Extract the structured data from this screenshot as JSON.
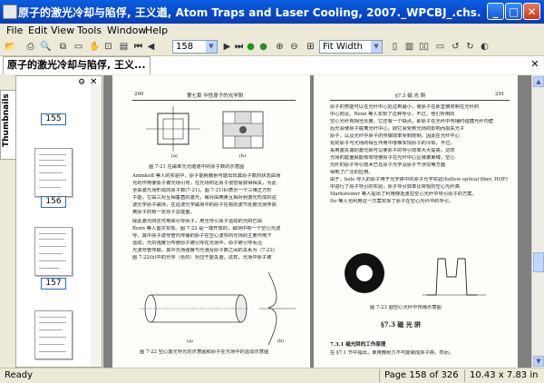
{
  "window": {
    "title": "原子的激光冷却与陷俘, 王义遒, Atom Traps and Laser Cooling, 2007._WPCBJ_.chs.djvu - WinDjView"
  },
  "menu": [
    "File",
    "Edit",
    "View",
    "Tools",
    "Window",
    "Help"
  ],
  "toolbar": {
    "page_number": "158",
    "zoom": "Fit Width"
  },
  "tab": {
    "label": "原子的激光冷却与陷俘, 王义..."
  },
  "sidebar": {
    "tab_label": "Thumbnails",
    "pages": [
      "155",
      "156",
      "157",
      "158"
    ]
  },
  "left_page": {
    "number": "290",
    "running_title": "第七章  中性原子的光学阱",
    "figure1_caption": "图 7-21  在磁单元光隧道中的原子数的示意图",
    "paragraphs": [
      "Ammkoff 等人的实验中，原子能耗散射可能出现其原子数的状态由场",
      "光的作用使原子被光场引导，在光场附近原子很容易获得相关，为此",
      "全由激光场形成的原子数(7-21)。图 7-21(b)表示一个三维正方形",
      "子能，它由三对互相垂直的激光，每对由两束互相对射激光形成的驻",
      "波光学原子磁场，在驻波光学磁场中的原子在有的波节处被光场俘获",
      "离原子的有一定原子总能量。",
      "除此激光阱还可用来引导原子，用光导引原子运动的光阱已由",
      "Renn 等人首次实现。图 7-22 是一端开放的，磁场中有一个空心光波",
      "导，其中原子波导管内传播的原子在空心波导的光场的主要作用下",
      "运动。光的强度分布使原子被引导在光场中，原子被引导而沿",
      "光波导管传输，其中光场强度与光强及原子数之间的关系为（7-22）",
      "图 7-22(b)中的光导（负的）对应于蓝失谐，这样，光场中原子被"
    ],
    "figure2_caption": "图 7-22  空心激光导光的示意图和原子在光场中的运动示意图"
  },
  "right_page": {
    "number": "291",
    "running_title": "§7.3  磁 光 阱",
    "paragraphs": [
      "原子的势能可以在光纤中心处达到最小，使原子在那里被限制在光纤的",
      "中心附近。Renn 等人实现了这种导引，不过，他们所用的",
      "空心光纤有相当长度，它还有一个缺点，即原子在光纤中传播时碰撞光纤内壁",
      "后光会使原子脱离光纤中心，即它会受到光场的影响而损失光子",
      "原子，以及光纤中原子的传输效率受到限制，因此在光纤中心",
      "处的原子与光场的相互作用中很难实现原子的冷却。不过，",
      "采用蓝失谐的激光就可以使原子的导引效率大大提高，这样",
      "光场的能量就能有效地使原子在光纤中心区域被束缚，空心",
      "光纤的原子导引技术已在原子光学及原子干涉仪等方面",
      "得到了广泛的应用。",
      "由于，hole 导入的原子用于光学阱中的原子光学实验(hollow optical fiber, HOF)",
      "中进行了原子导引的实验，原子导引效率比常规的空心光纤高",
      "Marksteiner 等人提出了利用倏逝波在空心光纤中导引原子的方案，",
      "Ito 等人也利用这一方案实现了原子在空心光纤中的导引。"
    ],
    "figure_caption": "图 7-23  圆空心光纤中传播示意图",
    "section_heading": "§7.3  磁 光 阱",
    "subsection": "7.3.1  磁光阱的工作原理",
    "last_line": "在 §7.1 节中指出，单用散射力不可能做成原子阱。然而，"
  },
  "status": {
    "ready": "Ready",
    "page": "Page 158 of 326",
    "size": "10.43 x 7.83 in"
  }
}
